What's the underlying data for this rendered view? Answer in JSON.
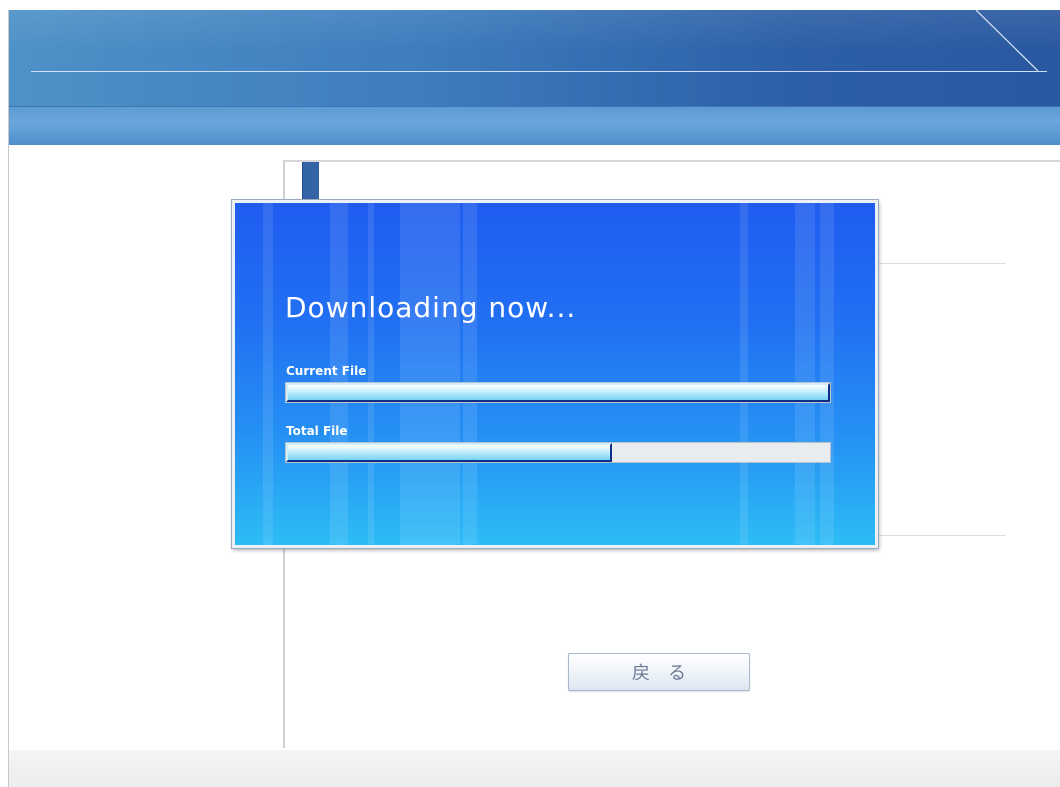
{
  "dialog": {
    "title": "Downloading now...",
    "current_file": {
      "label": "Current File",
      "progress": 1.0
    },
    "total_file": {
      "label": "Total File",
      "progress": 0.6
    }
  },
  "content": {
    "back_button_label": "戻る"
  },
  "colors": {
    "banner_dark": "#2a58a0",
    "banner_light": "#4e92c8",
    "dialog_top": "#1f5cf0",
    "dialog_bottom": "#2dbcf5",
    "progress_fill": "#9fe3fb",
    "progress_track": "#e9ecef"
  }
}
